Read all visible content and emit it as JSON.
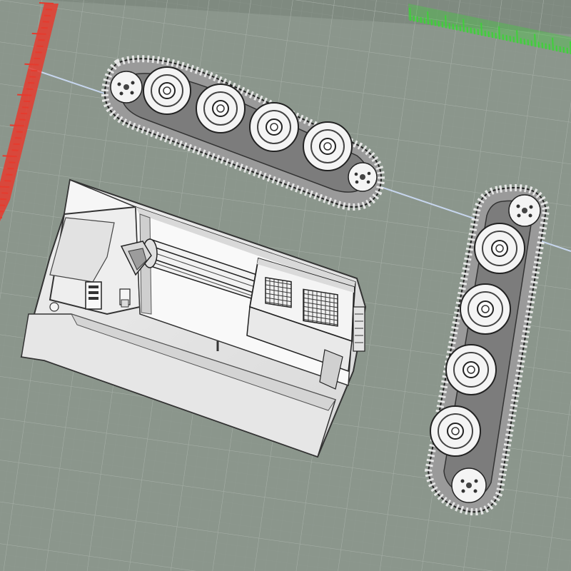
{
  "viewport": {
    "background_color": "#7f8a80",
    "bed_color": "#8b968c",
    "grid_color": "#a7b0a8",
    "axis_colors": {
      "x": "#e53b2e",
      "y": "#3fd13a",
      "z": "#c7d6ee"
    }
  },
  "model": {
    "part_color": "#f2f2f2",
    "shadow_color": "#cfcfcf",
    "edge_color": "#222222",
    "parts": [
      "hull",
      "track-left",
      "track-right"
    ]
  },
  "track_top": {
    "road_wheel_count": 4,
    "sprocket_count": 2
  },
  "track_right": {
    "road_wheel_count": 4,
    "sprocket_count": 2
  }
}
